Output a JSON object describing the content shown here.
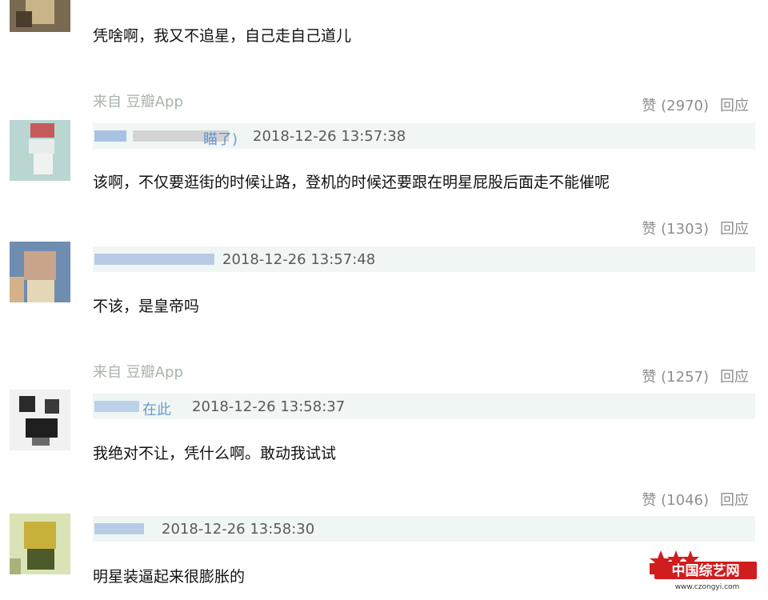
{
  "comments": [
    {
      "text": "凭啥啊，我又不追星，自己走自己道儿",
      "from": "来自 豆瓣App",
      "votes": "赞 (2970)",
      "reply": "回应"
    },
    {
      "user_tail": "瞄了)",
      "time": "2018-12-26 13:57:38",
      "text": "该啊，不仅要逛街的时候让路，登机的时候还要跟在明星屁股后面走不能催呢",
      "votes": "赞 (1303)",
      "reply": "回应"
    },
    {
      "time": "2018-12-26 13:57:48",
      "text": "不该，是皇帝吗",
      "from": "来自 豆瓣App",
      "votes": "赞 (1257)",
      "reply": "回应"
    },
    {
      "user_tail": "在此",
      "time": "2018-12-26 13:58:37",
      "text": "我绝对不让，凭什么啊。敢动我试试",
      "votes": "赞 (1046)",
      "reply": "回应"
    },
    {
      "time": "2018-12-26 13:58:30",
      "text": "明星装逼起来很膨胀的"
    }
  ],
  "watermark": {
    "name": "中国综艺网",
    "url": "www.czongyi.com"
  }
}
